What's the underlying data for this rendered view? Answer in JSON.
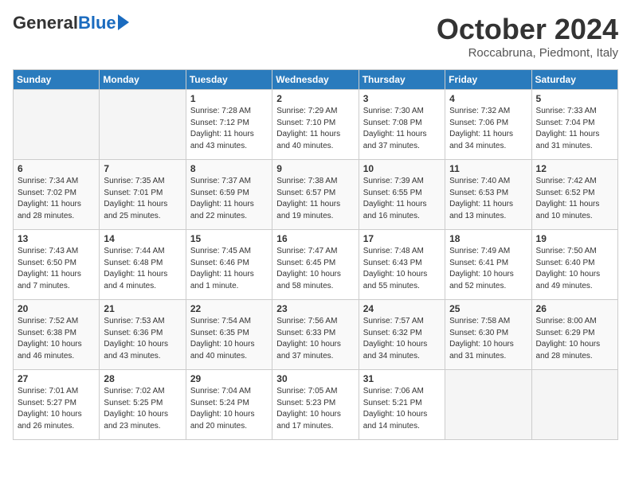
{
  "header": {
    "logo_general": "General",
    "logo_blue": "Blue",
    "month_title": "October 2024",
    "location": "Roccabruna, Piedmont, Italy"
  },
  "days_of_week": [
    "Sunday",
    "Monday",
    "Tuesday",
    "Wednesday",
    "Thursday",
    "Friday",
    "Saturday"
  ],
  "weeks": [
    [
      {
        "day": "",
        "info": ""
      },
      {
        "day": "",
        "info": ""
      },
      {
        "day": "1",
        "info": "Sunrise: 7:28 AM\nSunset: 7:12 PM\nDaylight: 11 hours and 43 minutes."
      },
      {
        "day": "2",
        "info": "Sunrise: 7:29 AM\nSunset: 7:10 PM\nDaylight: 11 hours and 40 minutes."
      },
      {
        "day": "3",
        "info": "Sunrise: 7:30 AM\nSunset: 7:08 PM\nDaylight: 11 hours and 37 minutes."
      },
      {
        "day": "4",
        "info": "Sunrise: 7:32 AM\nSunset: 7:06 PM\nDaylight: 11 hours and 34 minutes."
      },
      {
        "day": "5",
        "info": "Sunrise: 7:33 AM\nSunset: 7:04 PM\nDaylight: 11 hours and 31 minutes."
      }
    ],
    [
      {
        "day": "6",
        "info": "Sunrise: 7:34 AM\nSunset: 7:02 PM\nDaylight: 11 hours and 28 minutes."
      },
      {
        "day": "7",
        "info": "Sunrise: 7:35 AM\nSunset: 7:01 PM\nDaylight: 11 hours and 25 minutes."
      },
      {
        "day": "8",
        "info": "Sunrise: 7:37 AM\nSunset: 6:59 PM\nDaylight: 11 hours and 22 minutes."
      },
      {
        "day": "9",
        "info": "Sunrise: 7:38 AM\nSunset: 6:57 PM\nDaylight: 11 hours and 19 minutes."
      },
      {
        "day": "10",
        "info": "Sunrise: 7:39 AM\nSunset: 6:55 PM\nDaylight: 11 hours and 16 minutes."
      },
      {
        "day": "11",
        "info": "Sunrise: 7:40 AM\nSunset: 6:53 PM\nDaylight: 11 hours and 13 minutes."
      },
      {
        "day": "12",
        "info": "Sunrise: 7:42 AM\nSunset: 6:52 PM\nDaylight: 11 hours and 10 minutes."
      }
    ],
    [
      {
        "day": "13",
        "info": "Sunrise: 7:43 AM\nSunset: 6:50 PM\nDaylight: 11 hours and 7 minutes."
      },
      {
        "day": "14",
        "info": "Sunrise: 7:44 AM\nSunset: 6:48 PM\nDaylight: 11 hours and 4 minutes."
      },
      {
        "day": "15",
        "info": "Sunrise: 7:45 AM\nSunset: 6:46 PM\nDaylight: 11 hours and 1 minute."
      },
      {
        "day": "16",
        "info": "Sunrise: 7:47 AM\nSunset: 6:45 PM\nDaylight: 10 hours and 58 minutes."
      },
      {
        "day": "17",
        "info": "Sunrise: 7:48 AM\nSunset: 6:43 PM\nDaylight: 10 hours and 55 minutes."
      },
      {
        "day": "18",
        "info": "Sunrise: 7:49 AM\nSunset: 6:41 PM\nDaylight: 10 hours and 52 minutes."
      },
      {
        "day": "19",
        "info": "Sunrise: 7:50 AM\nSunset: 6:40 PM\nDaylight: 10 hours and 49 minutes."
      }
    ],
    [
      {
        "day": "20",
        "info": "Sunrise: 7:52 AM\nSunset: 6:38 PM\nDaylight: 10 hours and 46 minutes."
      },
      {
        "day": "21",
        "info": "Sunrise: 7:53 AM\nSunset: 6:36 PM\nDaylight: 10 hours and 43 minutes."
      },
      {
        "day": "22",
        "info": "Sunrise: 7:54 AM\nSunset: 6:35 PM\nDaylight: 10 hours and 40 minutes."
      },
      {
        "day": "23",
        "info": "Sunrise: 7:56 AM\nSunset: 6:33 PM\nDaylight: 10 hours and 37 minutes."
      },
      {
        "day": "24",
        "info": "Sunrise: 7:57 AM\nSunset: 6:32 PM\nDaylight: 10 hours and 34 minutes."
      },
      {
        "day": "25",
        "info": "Sunrise: 7:58 AM\nSunset: 6:30 PM\nDaylight: 10 hours and 31 minutes."
      },
      {
        "day": "26",
        "info": "Sunrise: 8:00 AM\nSunset: 6:29 PM\nDaylight: 10 hours and 28 minutes."
      }
    ],
    [
      {
        "day": "27",
        "info": "Sunrise: 7:01 AM\nSunset: 5:27 PM\nDaylight: 10 hours and 26 minutes."
      },
      {
        "day": "28",
        "info": "Sunrise: 7:02 AM\nSunset: 5:25 PM\nDaylight: 10 hours and 23 minutes."
      },
      {
        "day": "29",
        "info": "Sunrise: 7:04 AM\nSunset: 5:24 PM\nDaylight: 10 hours and 20 minutes."
      },
      {
        "day": "30",
        "info": "Sunrise: 7:05 AM\nSunset: 5:23 PM\nDaylight: 10 hours and 17 minutes."
      },
      {
        "day": "31",
        "info": "Sunrise: 7:06 AM\nSunset: 5:21 PM\nDaylight: 10 hours and 14 minutes."
      },
      {
        "day": "",
        "info": ""
      },
      {
        "day": "",
        "info": ""
      }
    ]
  ]
}
